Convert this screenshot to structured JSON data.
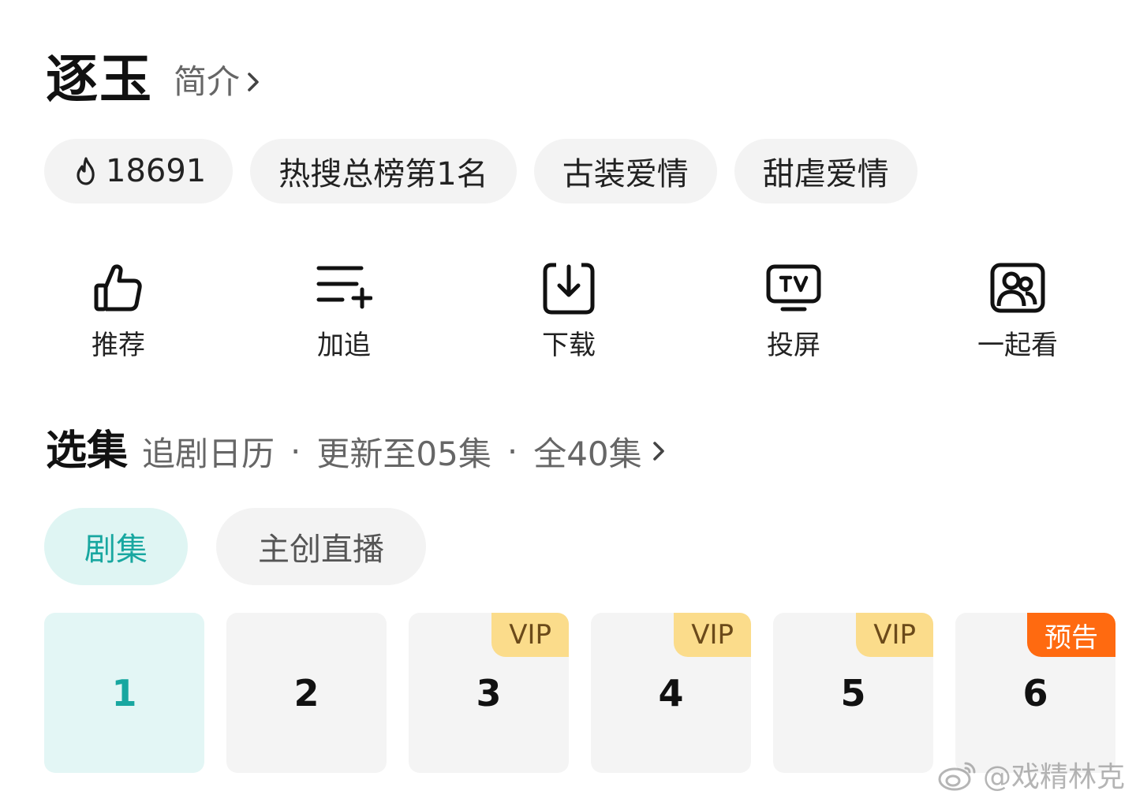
{
  "header": {
    "title": "逐玉",
    "intro_label": "简介"
  },
  "tags": [
    {
      "label": "18691",
      "icon": "flame-icon"
    },
    {
      "label": "热搜总榜第1名"
    },
    {
      "label": "古装爱情"
    },
    {
      "label": "甜虐爱情"
    }
  ],
  "actions": [
    {
      "label": "推荐",
      "icon": "thumbs-up-icon"
    },
    {
      "label": "加追",
      "icon": "add-to-list-icon"
    },
    {
      "label": "下载",
      "icon": "download-icon"
    },
    {
      "label": "投屏",
      "icon": "tv-cast-icon"
    },
    {
      "label": "一起看",
      "icon": "watch-together-icon"
    }
  ],
  "episodes": {
    "title": "选集",
    "calendar": "追剧日历",
    "updated": "更新至05集",
    "total": "全40集",
    "separator": "·"
  },
  "segments": [
    {
      "label": "剧集",
      "active": true
    },
    {
      "label": "主创直播",
      "active": false
    }
  ],
  "tiles": [
    {
      "number": "1",
      "badge": ""
    },
    {
      "number": "2",
      "badge": ""
    },
    {
      "number": "3",
      "badge": "VIP"
    },
    {
      "number": "4",
      "badge": "VIP"
    },
    {
      "number": "5",
      "badge": "VIP"
    },
    {
      "number": "6",
      "badge": "预告"
    }
  ],
  "watermark": "@戏精林克",
  "colors": {
    "accent": "#18a7a0",
    "accent_bg": "#dff5f3",
    "vip_bg": "#fbdc8b",
    "preview_bg": "#ff6a10"
  }
}
